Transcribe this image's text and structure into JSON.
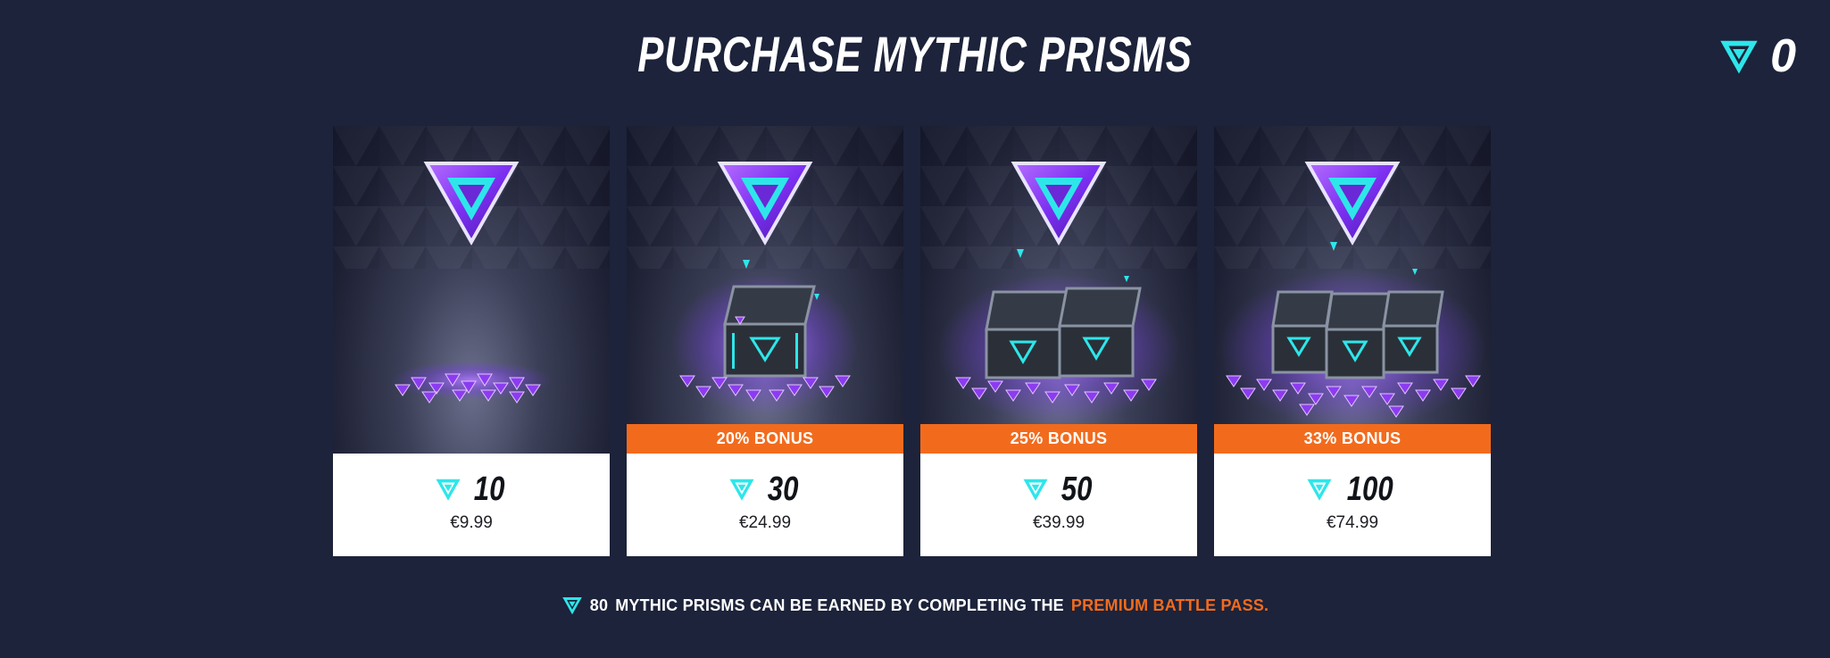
{
  "header": {
    "title": "PURCHASE MYTHIC PRISMS",
    "balance": "0",
    "balance_icon": "mythic-prism-icon"
  },
  "colors": {
    "background": "#1c233a",
    "accent_cyan": "#2ee6ea",
    "bonus_orange": "#f26b1d",
    "prism_purple": "#7b2ff0"
  },
  "offers": [
    {
      "amount": "10",
      "price": "€9.99",
      "bonus": "",
      "chests": 0
    },
    {
      "amount": "30",
      "price": "€24.99",
      "bonus": "20% BONUS",
      "chests": 1
    },
    {
      "amount": "50",
      "price": "€39.99",
      "bonus": "25% BONUS",
      "chests": 2
    },
    {
      "amount": "100",
      "price": "€74.99",
      "bonus": "33% BONUS",
      "chests": 3
    }
  ],
  "footer": {
    "count": "80",
    "text": "MYTHIC PRISMS CAN BE EARNED BY COMPLETING THE",
    "link": "PREMIUM BATTLE PASS."
  }
}
